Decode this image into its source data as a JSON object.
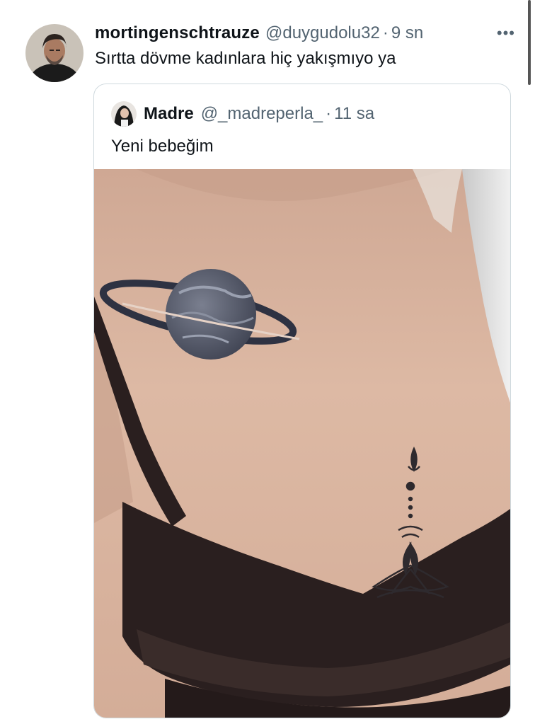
{
  "tweet": {
    "display_name": "mortingenschtrauze",
    "handle": "@duygudolu32",
    "separator": "·",
    "time": "9 sn",
    "more_icon": "ellipsis-icon",
    "text": "Sırtta dövme kadınlara hiç yakışmıyo ya"
  },
  "quote": {
    "display_name": "Madre",
    "handle": "@_madreperla_",
    "separator": "·",
    "time": "11 sa",
    "text": "Yeni bebeğim",
    "media_description_icon": "photo"
  },
  "colors": {
    "text_primary": "#0f1419",
    "text_secondary": "#536471",
    "border": "#cfd9de",
    "skin": "#d9b29c",
    "bra": "#2a1f1f"
  }
}
